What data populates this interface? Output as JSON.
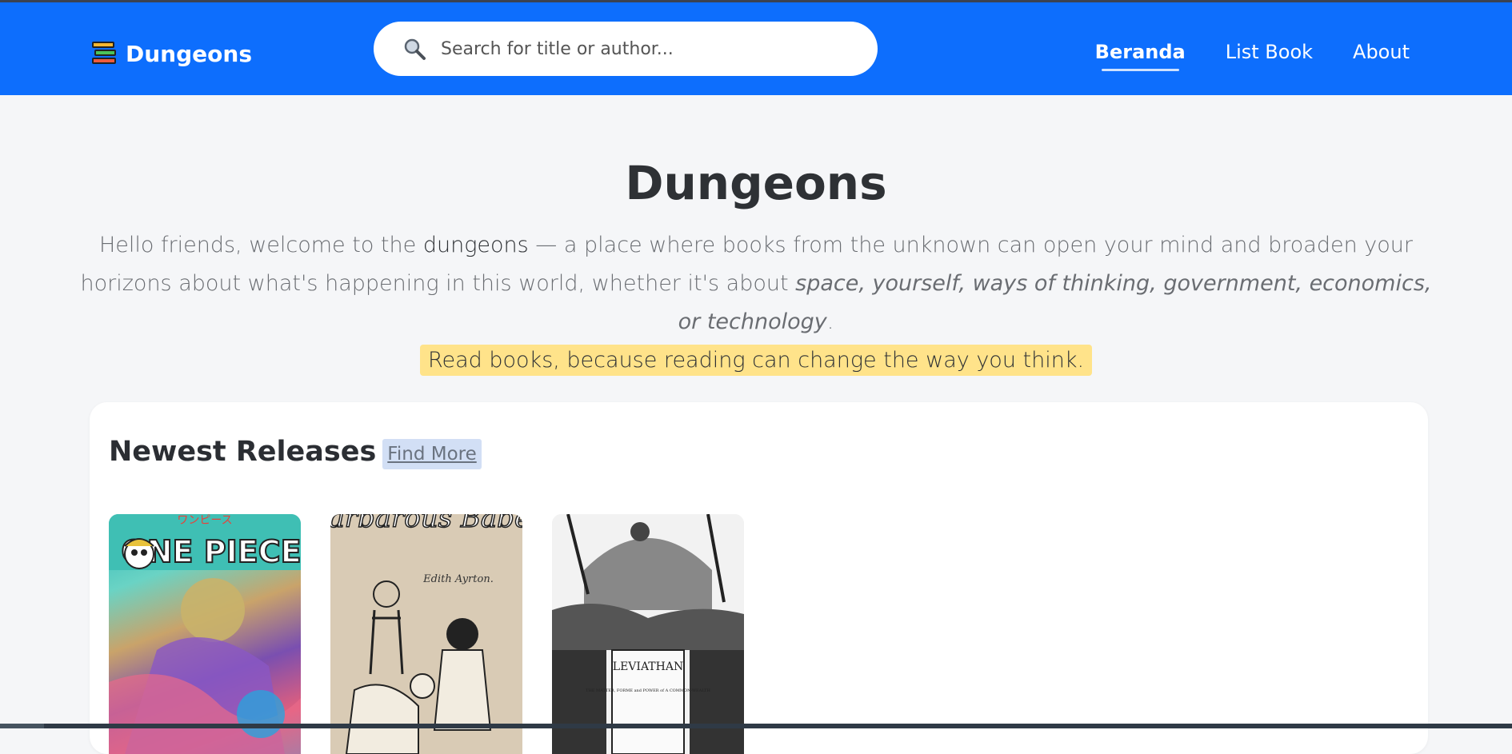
{
  "navbar": {
    "brand": "Dungeons",
    "search_placeholder": "Search for title or author...",
    "links": [
      {
        "label": "Beranda",
        "active": true
      },
      {
        "label": "List Book",
        "active": false
      },
      {
        "label": "About",
        "active": false
      }
    ],
    "background": "#0d6efd"
  },
  "hero": {
    "title": "Dungeons",
    "text_1": "Hello friends, welcome to the ",
    "text_strong": "dungeons",
    "text_2": " — a place where books from the unknown can open your mind and broaden your horizons about what's happening in this world, whether it's about ",
    "text_italic": "space, yourself, ways of thinking, government, economics, or technology",
    "text_3": ".",
    "highlight": "Read books, because reading can change the way you think.",
    "highlight_color": "#ffe38a"
  },
  "releases": {
    "title": "Newest Releases",
    "find_more": "Find More",
    "books": [
      {
        "cover_title": "ONE PIECE",
        "cover_subtitle": "ワンピース"
      },
      {
        "cover_title": "Barbarous Babes",
        "cover_subtitle": "Edith Ayrton."
      },
      {
        "cover_title": "LEVIATHAN",
        "cover_subtitle": "THE MATTER, FORME and POWER of A COMMON-WEALTH"
      }
    ]
  }
}
